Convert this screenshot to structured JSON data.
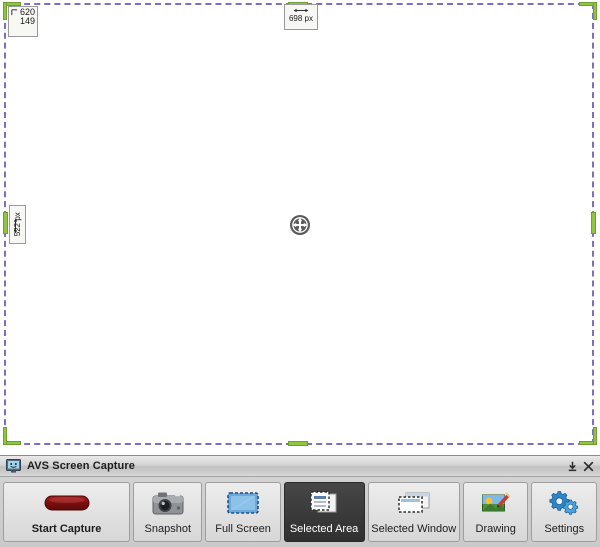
{
  "app": {
    "title": "AVS Screen Capture",
    "icon": "monitor-icon",
    "window_controls": [
      {
        "name": "minimize-button",
        "icon": "minimize-to-tray-icon",
        "label": "⤓"
      },
      {
        "name": "close-button",
        "icon": "close-icon",
        "label": "✕"
      }
    ]
  },
  "toolbar": {
    "buttons": [
      {
        "id": "start-capture",
        "label": "Start Capture",
        "icon": "record-button-icon",
        "active": false
      },
      {
        "id": "snapshot",
        "label": "Snapshot",
        "icon": "camera-icon",
        "active": false
      },
      {
        "id": "full-screen",
        "label": "Full Screen",
        "icon": "full-screen-icon",
        "active": false
      },
      {
        "id": "selected-area",
        "label": "Selected Area",
        "icon": "selected-area-icon",
        "active": true
      },
      {
        "id": "selected-window",
        "label": "Selected Window",
        "icon": "selected-window-icon",
        "active": false
      },
      {
        "id": "drawing",
        "label": "Drawing",
        "icon": "drawing-pencil-icon",
        "active": false
      },
      {
        "id": "settings",
        "label": "Settings",
        "icon": "gears-icon",
        "active": false
      }
    ]
  },
  "capture": {
    "mode": "Selected Area",
    "position": {
      "icon": "corner-arrow-icon",
      "x": "620",
      "y": "149"
    },
    "width_tooltip": {
      "icon": "horizontal-double-arrow-icon",
      "value": "698 px"
    },
    "height_tooltip": {
      "icon": "vertical-double-arrow-icon",
      "value": "522 px"
    },
    "move_handle_icon": "move-crosshair-icon",
    "colors": {
      "selection_border": "#7a6fc0",
      "handle_fill": "#8ec63f",
      "handle_stroke": "#6f9f2f",
      "active_button_bg": "#3b3b3b",
      "record_red": "#8e1212"
    }
  }
}
